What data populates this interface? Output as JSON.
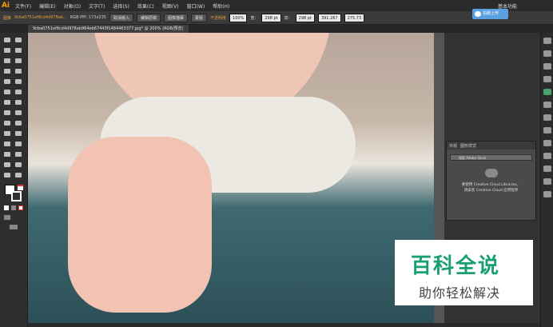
{
  "app": {
    "logo": "Ai"
  },
  "menu": [
    "文件(F)",
    "编辑(E)",
    "对象(O)",
    "文字(T)",
    "选择(S)",
    "效果(C)",
    "视图(V)",
    "窗口(W)",
    "帮助(H)"
  ],
  "workspace": "基本功能",
  "control_bar": {
    "object_type": "图像",
    "filename": "9cba0751ef8cd4d978ab...",
    "color_info": "RGB PPI: 173x235",
    "cancel_embed": "取消嵌入",
    "edit_original": "编辑原稿",
    "image_trace": "图像描摹",
    "mask": "蒙版",
    "opacity_label": "不透明度",
    "opacity_value": "100%",
    "w_label": "宽：",
    "w_value": "298 pt",
    "h_label": "高：",
    "h_value": "298 pt",
    "x_value": "391.267",
    "y_value": "275.73"
  },
  "cloud_upload": "拍摄上传",
  "document_tab": "9cba0751ef8cd4d978ab964eb67443f1484463377.jpg* @ 200% (RGB/预览)",
  "libraries_panel": {
    "tabs": [
      "外观",
      "图形样式"
    ],
    "search_placeholder": "搜索 Adobe Stock",
    "line1": "要使用 Creative Cloud Libraries，",
    "line2": "请安装 Creative Cloud 应用程序"
  },
  "watermark": {
    "title": "百科全说",
    "subtitle": "助你轻松解决"
  },
  "colors": {
    "accent": "#1a9f70",
    "panel_bg": "#323232",
    "cloud_btn": "#5aa0e0"
  }
}
